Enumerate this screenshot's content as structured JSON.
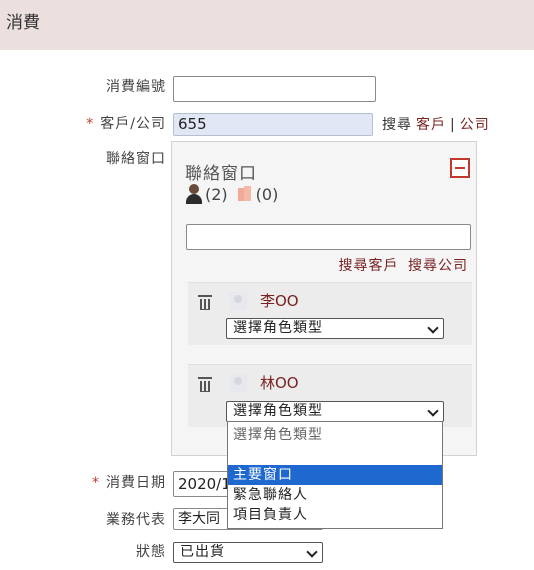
{
  "header": {
    "title": "消費"
  },
  "form": {
    "consumption_no": {
      "label": "消費編號",
      "value": ""
    },
    "customer": {
      "label": "客戶/公司",
      "value": "655",
      "search_label": "搜尋",
      "customer_link": "客戶",
      "separator": "|",
      "company_link": "公司"
    },
    "contact": {
      "label": "聯絡窗口",
      "panel_title": "聯絡窗口",
      "person_count": "(2)",
      "company_count": "(0)",
      "search_value": "",
      "search_customer_link": "搜尋客戶",
      "search_company_link": "搜尋公司",
      "contacts": [
        {
          "name": "李OO",
          "role": "選擇角色類型"
        },
        {
          "name": "林OO",
          "role": "選擇角色類型"
        }
      ],
      "role_options": [
        "選擇角色類型",
        "",
        "主要窗口",
        "緊急聯絡人",
        "項目負責人"
      ],
      "highlighted_option": "主要窗口"
    },
    "date": {
      "label": "消費日期",
      "value": "2020/1"
    },
    "sales_rep": {
      "label": "業務代表",
      "value": "李大同"
    },
    "status": {
      "label": "狀態",
      "value": "已出貨"
    }
  }
}
